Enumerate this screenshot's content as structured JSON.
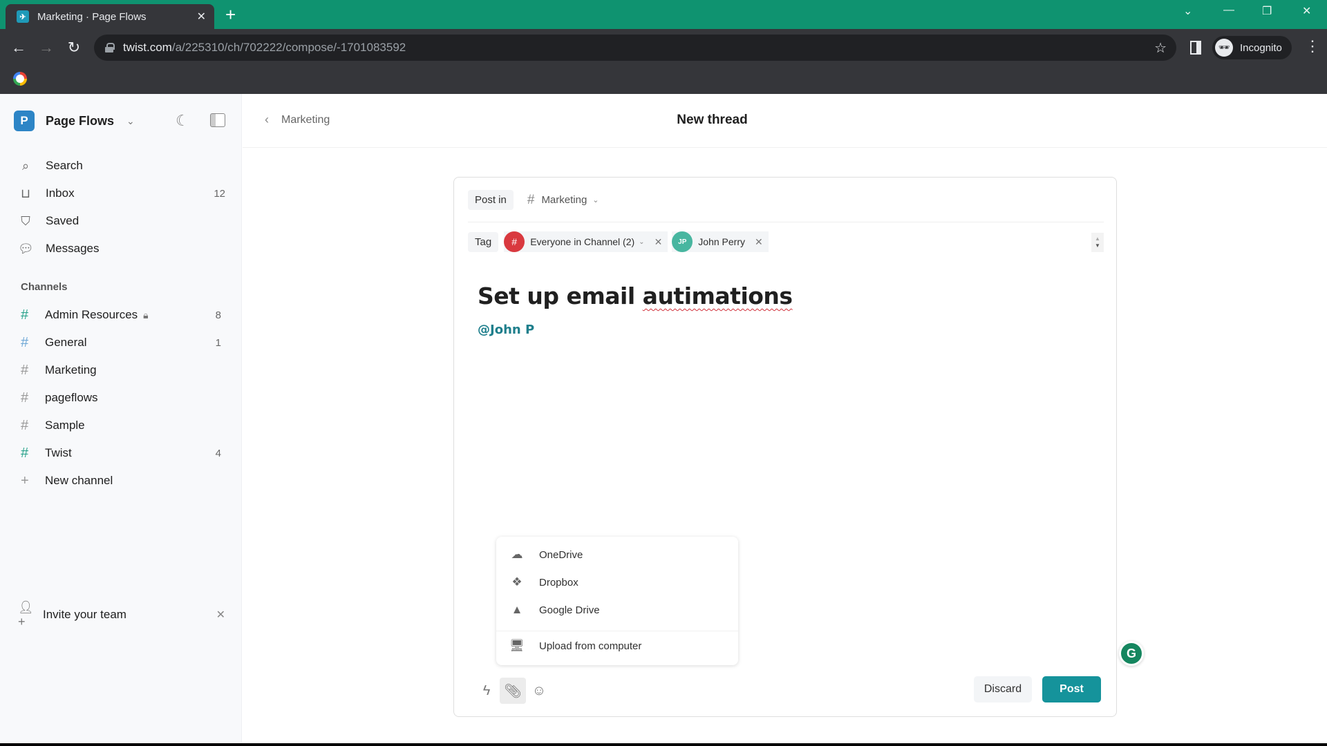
{
  "browser": {
    "tab_title": "Marketing · Page Flows",
    "url_host": "twist.com",
    "url_path": "/a/225310/ch/702222/compose/-1701083592",
    "profile_label": "Incognito"
  },
  "workspace": {
    "initial": "P",
    "name": "Page Flows"
  },
  "nav": [
    {
      "icon": "search-icon",
      "label": "Search",
      "count": ""
    },
    {
      "icon": "inbox-icon",
      "label": "Inbox",
      "count": "12"
    },
    {
      "icon": "bookmark-icon",
      "label": "Saved",
      "count": ""
    },
    {
      "icon": "chat-bubble-icon",
      "label": "Messages",
      "count": ""
    }
  ],
  "channels_label": "Channels",
  "channels": [
    {
      "name": "Admin Resources",
      "count": "8",
      "locked": true,
      "hash_color": "#2aa38c"
    },
    {
      "name": "General",
      "count": "1",
      "locked": false,
      "hash_color": "#6fa8d6"
    },
    {
      "name": "Marketing",
      "count": "",
      "locked": false,
      "hash_color": "#999999"
    },
    {
      "name": "pageflows",
      "count": "",
      "locked": false,
      "hash_color": "#999999"
    },
    {
      "name": "Sample",
      "count": "",
      "locked": false,
      "hash_color": "#999999"
    },
    {
      "name": "Twist",
      "count": "4",
      "locked": false,
      "hash_color": "#2aa38c"
    }
  ],
  "new_channel_label": "New channel",
  "invite_label": "Invite your team",
  "header": {
    "back_label": "Marketing",
    "title": "New thread"
  },
  "composer": {
    "post_in_label": "Post in",
    "channel": "Marketing",
    "tag_label": "Tag",
    "tags": [
      {
        "initials": "#",
        "label": "Everyone in Channel (2)",
        "color": "#d9393f",
        "has_dropdown": true
      },
      {
        "initials": "JP",
        "label": "John Perry",
        "color": "#48b6a0",
        "has_dropdown": false
      }
    ],
    "title_text_prefix": "Set up email ",
    "title_text_misspelled": "autimations",
    "body_mention": "@John P",
    "attach_menu": [
      {
        "icon": "onedrive-icon",
        "label": "OneDrive"
      },
      {
        "icon": "dropbox-icon",
        "label": "Dropbox"
      },
      {
        "icon": "google-drive-icon",
        "label": "Google Drive"
      },
      {
        "icon": "computer-icon",
        "label": "Upload from computer"
      }
    ],
    "discard_label": "Discard",
    "post_label": "Post"
  },
  "colors": {
    "accent": "#15939b",
    "titlebar": "#0f9370",
    "mention": "#1f7f8c"
  }
}
